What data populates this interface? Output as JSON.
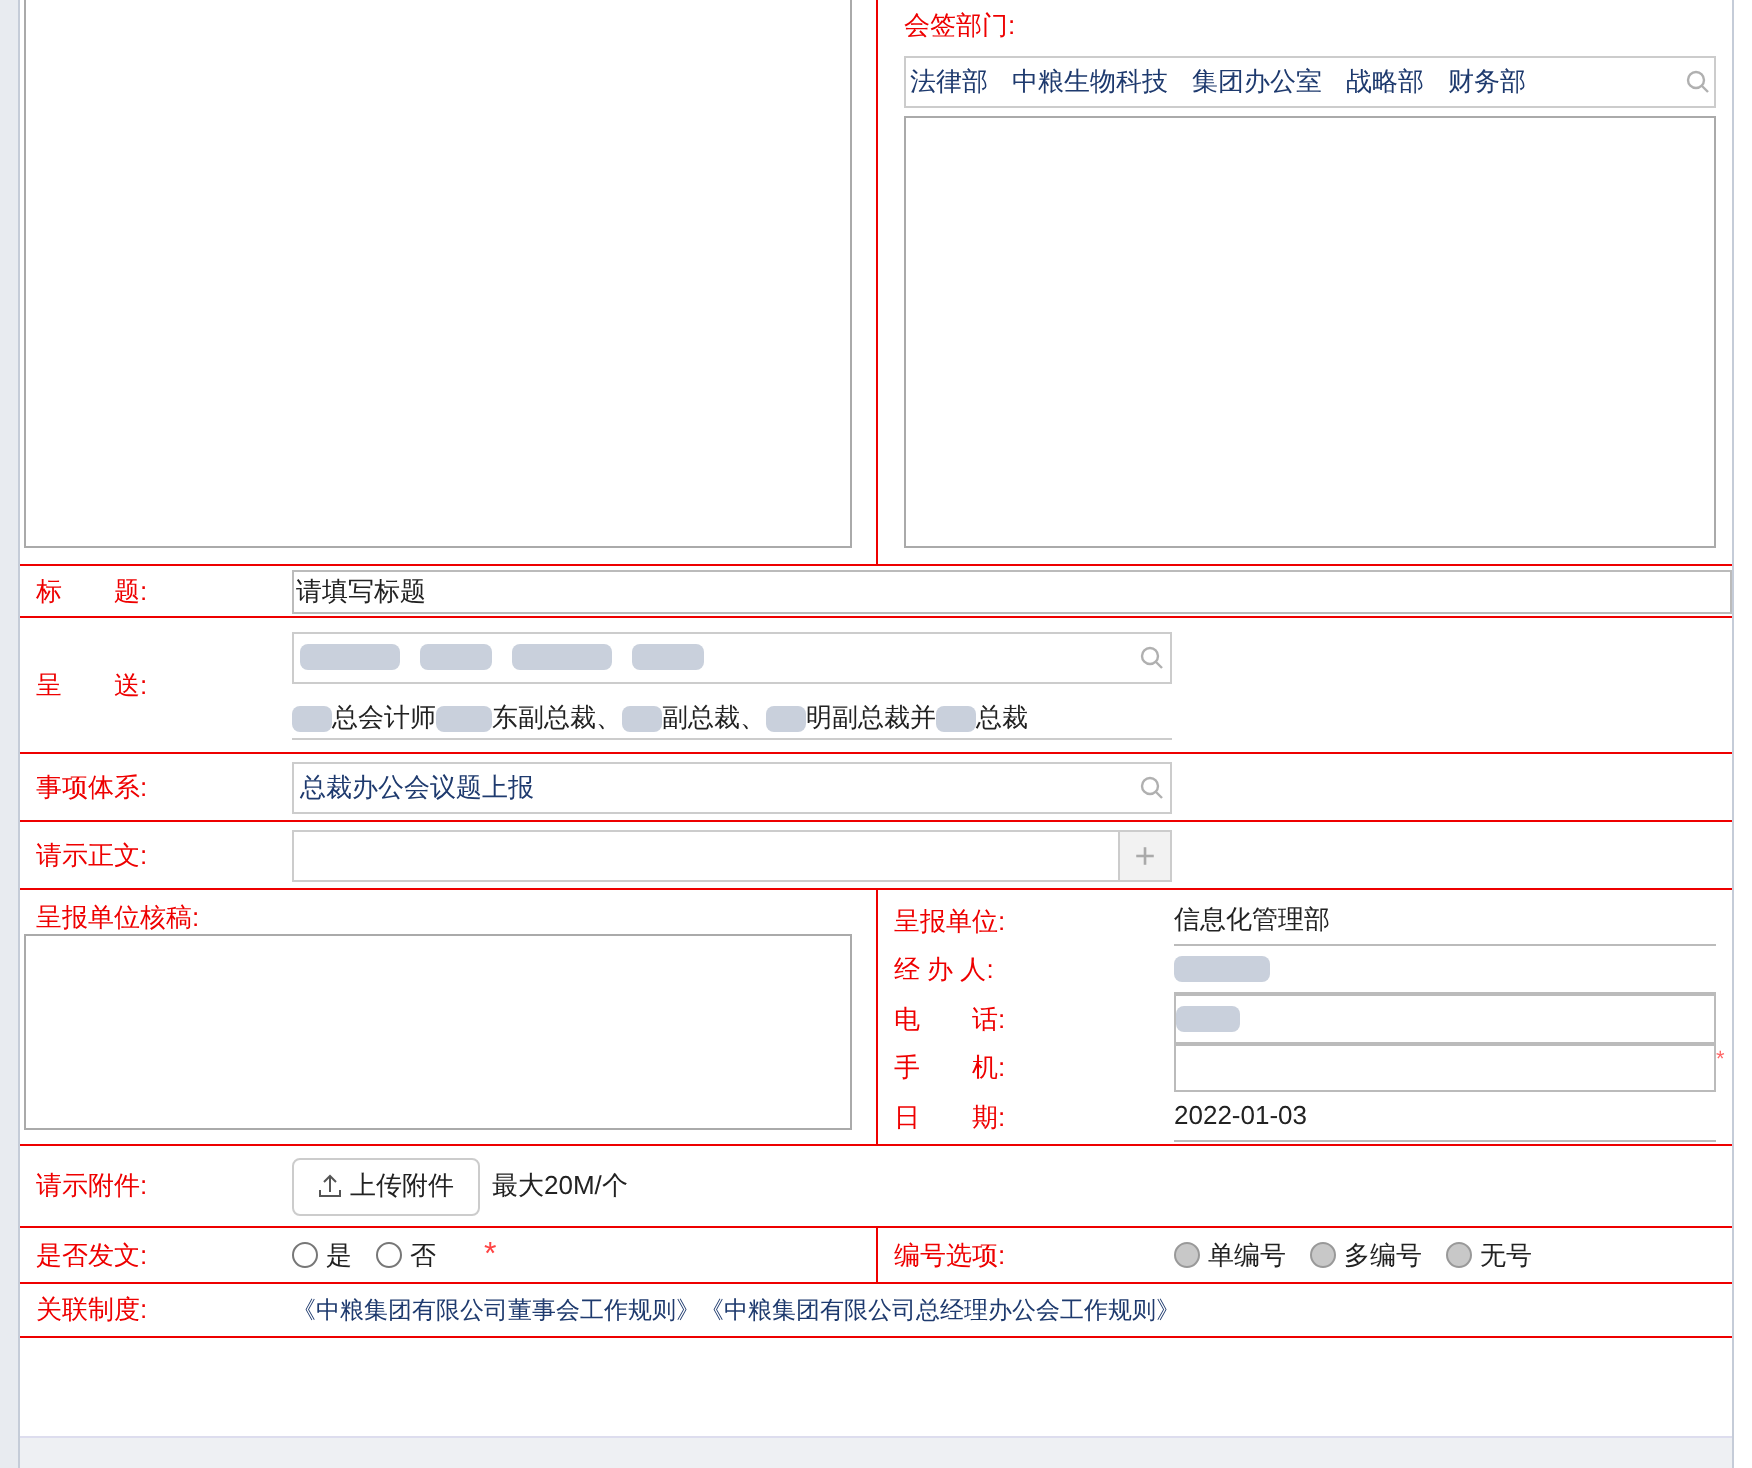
{
  "countersign": {
    "label": "会签部门:",
    "departments": [
      "法律部",
      "中粮生物科技",
      "集团办公室",
      "战略部",
      "财务部"
    ]
  },
  "title_row": {
    "label": "标　　题:",
    "value": "请填写标题"
  },
  "submit_to": {
    "label": "呈　　送:",
    "recipients_line": [
      "总会计师",
      "东副总裁、",
      "副总裁、",
      "明副总裁并",
      "总裁"
    ]
  },
  "matter_system": {
    "label": "事项体系:",
    "value": "总裁办公会议题上报"
  },
  "body_text": {
    "label": "请示正文:",
    "add_symbol": "+"
  },
  "unit_review": {
    "label": "呈报单位核稿:"
  },
  "unit_info": [
    {
      "label": "呈报单位:",
      "value": "信息化管理部",
      "kind": "text"
    },
    {
      "label": "经 办 人:",
      "kind": "redacted"
    },
    {
      "label": "电　　话:",
      "kind": "input_redacted"
    },
    {
      "label": "手　　机:",
      "kind": "input",
      "required_mark": "*"
    },
    {
      "label": "日　　期:",
      "value": "2022-01-03",
      "kind": "text"
    }
  ],
  "attachment": {
    "label": "请示附件:",
    "button": "上传附件",
    "note": "最大20M/个"
  },
  "publish": {
    "label": "是否发文:",
    "options": [
      {
        "label": "是",
        "selected": false
      },
      {
        "label": "否",
        "selected": false
      }
    ],
    "required_mark": "*"
  },
  "numbering": {
    "label": "编号选项:",
    "disabled": true,
    "options": [
      {
        "label": "单编号",
        "selected": false
      },
      {
        "label": "多编号",
        "selected": false
      },
      {
        "label": "无号",
        "selected": false
      }
    ]
  },
  "related_rules": {
    "label": "关联制度:",
    "links": [
      "《中粮集团有限公司董事会工作规则》",
      "《中粮集团有限公司总经理办公会工作规则》"
    ]
  }
}
